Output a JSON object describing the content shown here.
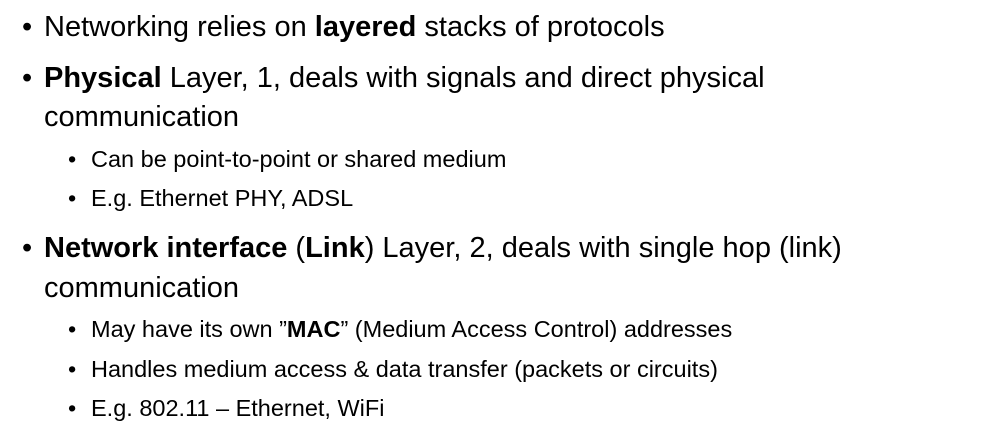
{
  "bullets": [
    {
      "level": 1,
      "segments": [
        {
          "t": "Networking relies on ",
          "b": false
        },
        {
          "t": "layered",
          "b": true
        },
        {
          "t": " stacks of protocols",
          "b": false
        }
      ]
    },
    {
      "level": 1,
      "segments": [
        {
          "t": "Physical",
          "b": true
        },
        {
          "t": " Layer, 1, deals with signals and direct physical",
          "b": false
        }
      ],
      "continuation": "communication"
    },
    {
      "level": 2,
      "segments": [
        {
          "t": "Can be point-to-point or shared medium",
          "b": false
        }
      ]
    },
    {
      "level": 2,
      "segments": [
        {
          "t": "E.g. Ethernet PHY, ADSL",
          "b": false
        }
      ]
    },
    {
      "level": 1,
      "segments": [
        {
          "t": "Network interface",
          "b": true
        },
        {
          "t": " (",
          "b": false
        },
        {
          "t": "Link",
          "b": true
        },
        {
          "t": ") Layer, 2, deals with single hop (link)",
          "b": false
        }
      ],
      "continuation": "communication"
    },
    {
      "level": 2,
      "segments": [
        {
          "t": "May have its own ”",
          "b": false
        },
        {
          "t": "MAC",
          "b": true
        },
        {
          "t": "” (Medium Access Control) addresses",
          "b": false
        }
      ]
    },
    {
      "level": 2,
      "segments": [
        {
          "t": "Handles medium access & data transfer (packets or circuits)",
          "b": false
        }
      ]
    },
    {
      "level": 2,
      "segments": [
        {
          "t": "E.g. 802.11 – Ethernet, WiFi",
          "b": false
        }
      ]
    }
  ],
  "bullet_glyph": "•"
}
